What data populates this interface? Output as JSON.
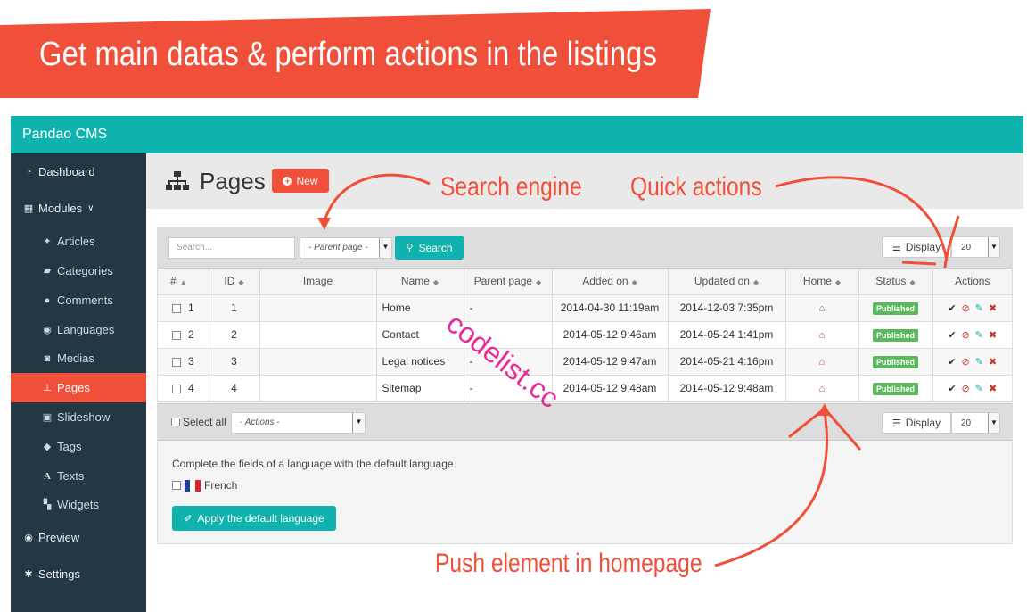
{
  "banner": {
    "text": "Get main datas & perform actions in the listings"
  },
  "app": {
    "title": "Pandao CMS"
  },
  "sidebar": {
    "items": [
      {
        "label": "Dashboard",
        "icon": "dashboard-icon"
      },
      {
        "label": "Modules",
        "icon": "grid-icon",
        "caret": "⌄"
      },
      {
        "label": "Articles",
        "icon": "pin-icon"
      },
      {
        "label": "Categories",
        "icon": "folder-icon"
      },
      {
        "label": "Comments",
        "icon": "comment-icon"
      },
      {
        "label": "Languages",
        "icon": "globe-icon"
      },
      {
        "label": "Medias",
        "icon": "camera-icon"
      },
      {
        "label": "Pages",
        "icon": "sitemap-icon",
        "active": true
      },
      {
        "label": "Slideshow",
        "icon": "image-icon"
      },
      {
        "label": "Tags",
        "icon": "tag-icon"
      },
      {
        "label": "Texts",
        "icon": "text-icon"
      },
      {
        "label": "Widgets",
        "icon": "widgets-icon"
      },
      {
        "label": "Preview",
        "icon": "eye-icon"
      },
      {
        "label": "Settings",
        "icon": "gear-icon"
      }
    ]
  },
  "page": {
    "title": "Pages",
    "new_label": "New"
  },
  "toolbar": {
    "search_placeholder": "Search...",
    "parent_select": "- Parent page -",
    "search_label": "Search",
    "display_label": "Display",
    "display_count": "20"
  },
  "table": {
    "headers": [
      "#",
      "ID",
      "Image",
      "Name",
      "Parent page",
      "Added on",
      "Updated on",
      "Home",
      "Status",
      "Actions"
    ],
    "rows": [
      {
        "num": "1",
        "id": "1",
        "name": "Home",
        "parent": "-",
        "added": "2014-04-30 11:19am",
        "updated": "2014-12-03 7:35pm",
        "home": true,
        "status": "Published"
      },
      {
        "num": "2",
        "id": "2",
        "name": "Contact",
        "parent": "-",
        "added": "2014-05-12 9:46am",
        "updated": "2014-05-24 1:41pm",
        "home": false,
        "status": "Published"
      },
      {
        "num": "3",
        "id": "3",
        "name": "Legal notices",
        "parent": "-",
        "added": "2014-05-12 9:47am",
        "updated": "2014-05-21 4:16pm",
        "home": false,
        "status": "Published"
      },
      {
        "num": "4",
        "id": "4",
        "name": "Sitemap",
        "parent": "-",
        "added": "2014-05-12 9:48am",
        "updated": "2014-05-12 9:48am",
        "home": false,
        "status": "Published"
      }
    ]
  },
  "bottom": {
    "select_all": "Select all",
    "actions_select": "- Actions -",
    "display_label": "Display",
    "display_count": "20"
  },
  "language_section": {
    "text": "Complete the fields of a language with the default language",
    "language": "French",
    "apply_label": "Apply the default language"
  },
  "annotations": {
    "search_engine": "Search engine",
    "quick_actions": "Quick actions",
    "push_homepage": "Push element in homepage"
  },
  "watermark": "codelist.cc",
  "colors": {
    "accent_red": "#f0503a",
    "teal": "#0fb2ac",
    "sidebar_bg": "#243745",
    "published_green": "#5cb85c",
    "home_active": "#3a8a3a",
    "home_inactive": "#c0392b"
  }
}
